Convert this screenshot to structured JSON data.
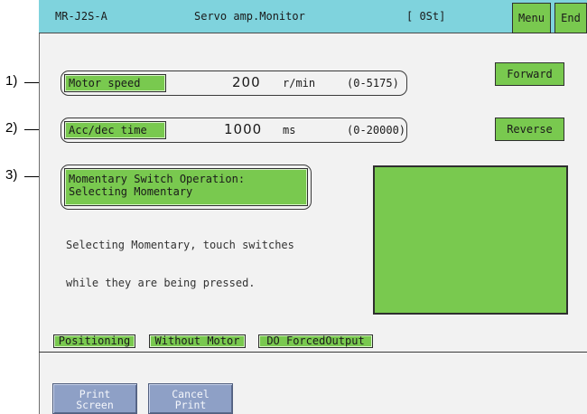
{
  "callouts": [
    "1)",
    "2)",
    "3)"
  ],
  "header": {
    "model": "MR-J2S-A",
    "title": "Servo amp.Monitor",
    "station": "[ 0St]",
    "menu_label": "Menu",
    "end_label": "End"
  },
  "rows": [
    {
      "label": "Motor speed",
      "value": "200",
      "unit": "r/min",
      "range": "(0-5175)"
    },
    {
      "label": "Acc/dec time",
      "value": "1000",
      "unit": "ms",
      "range": "(0-20000)"
    }
  ],
  "momentary_button": {
    "line1": "Momentary Switch Operation:",
    "line2": "Selecting Momentary"
  },
  "description": {
    "line1": "Selecting Momentary, touch switches",
    "line2": "while they are being pressed."
  },
  "direction_buttons": {
    "forward": "Forward",
    "reverse": "Reverse"
  },
  "mode_tabs": [
    "Positioning",
    "Without Motor",
    "DO ForcedOutput"
  ],
  "footer_buttons": {
    "print": "Print\nScreen",
    "cancel": "Cancel\nPrint"
  },
  "colors": {
    "title_bar": "#7fd3dd",
    "button_green": "#79c94f",
    "footer_button": "#8ea0c6",
    "screen_bg": "#f2f2f2"
  }
}
